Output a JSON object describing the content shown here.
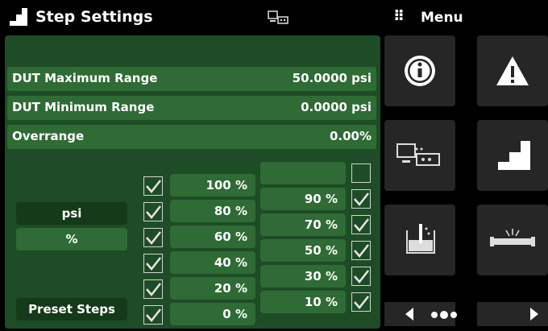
{
  "header": {
    "title": "Step Settings",
    "menu_label": "Menu",
    "menu_dots": "⠿"
  },
  "settings": {
    "max_range": {
      "label": "DUT Maximum Range",
      "value": "50.0000 psi"
    },
    "min_range": {
      "label": "DUT Minimum Range",
      "value": "0.0000 psi"
    },
    "overrange": {
      "label": "Overrange",
      "value": "0.00%"
    }
  },
  "units": {
    "psi": "psi",
    "percent": "%",
    "selected": "%"
  },
  "preset_steps": "Preset Steps",
  "steps_left": [
    {
      "label": "100 %",
      "checked": true
    },
    {
      "label": "80 %",
      "checked": true
    },
    {
      "label": "60 %",
      "checked": true
    },
    {
      "label": "40 %",
      "checked": true
    },
    {
      "label": "20 %",
      "checked": true
    },
    {
      "label": "0 %",
      "checked": true
    }
  ],
  "steps_right": [
    {
      "label": "",
      "checked": false
    },
    {
      "label": "90 %",
      "checked": true
    },
    {
      "label": "70 %",
      "checked": true
    },
    {
      "label": "50 %",
      "checked": true
    },
    {
      "label": "30 %",
      "checked": true
    },
    {
      "label": "10 %",
      "checked": true
    }
  ],
  "tiles": [
    "info-icon",
    "warning-icon",
    "remote-display-icon",
    "step-icon",
    "measure-tank-icon",
    "leak-pipe-icon"
  ],
  "colors": {
    "panel": "#1e4c26",
    "field": "#2f6b35",
    "dark_field": "#143a1a",
    "tile": "#262626"
  }
}
